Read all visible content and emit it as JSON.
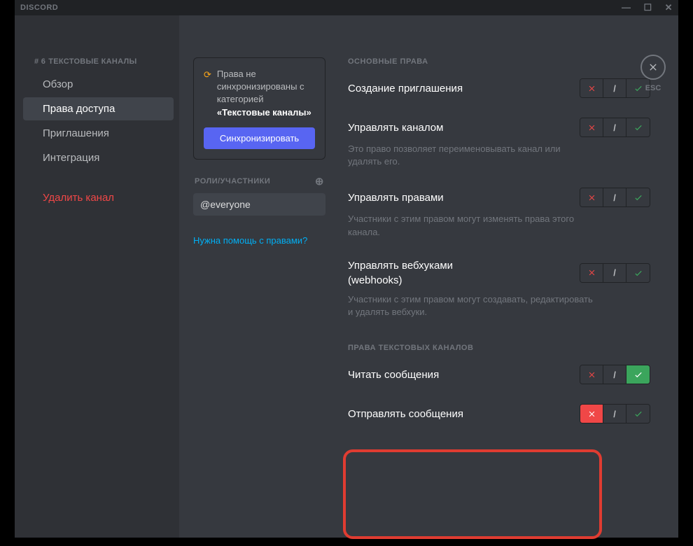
{
  "titlebar": {
    "app": "DISCORD"
  },
  "sidebar": {
    "header_prefix": "# 6",
    "header": "ТЕКСТОВЫЕ КАНАЛЫ",
    "items": [
      "Обзор",
      "Права доступа",
      "Приглашения",
      "Интеграция"
    ],
    "delete": "Удалить канал"
  },
  "middle": {
    "sync_text_pre": "Права не синхронизированы с категорией",
    "sync_text_bold": "«Текстовые каналы»",
    "sync_button": "Синхронизировать",
    "roles_header": "РОЛИ/УЧАСТНИКИ",
    "role": "@everyone",
    "help": "Нужна помощь с правами?"
  },
  "main": {
    "section1": "ОСНОВНЫЕ ПРАВА",
    "perms1": [
      {
        "title": "Создание приглашения",
        "desc": ""
      },
      {
        "title": "Управлять каналом",
        "desc": "Это право позволяет переименовывать канал или удалять его."
      },
      {
        "title": "Управлять правами",
        "desc": "Участники с этим правом могут изменять права этого канала."
      },
      {
        "title": "Управлять вебхуками (webhooks)",
        "desc": "Участники с этим правом могут создавать, редактировать и удалять вебхуки."
      }
    ],
    "section2": "ПРАВА ТЕКСТОВЫХ КАНАЛОВ",
    "perms2": [
      {
        "title": "Читать сообщения",
        "state": "allow"
      },
      {
        "title": "Отправлять сообщения",
        "state": "deny"
      }
    ]
  },
  "close": {
    "esc": "ESC"
  }
}
